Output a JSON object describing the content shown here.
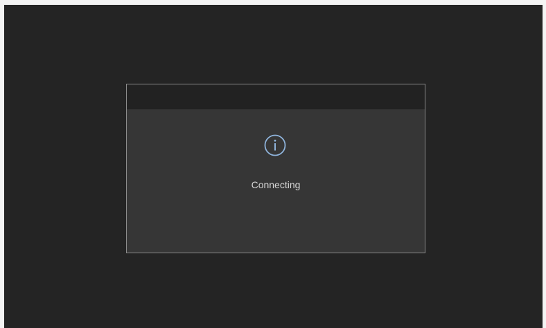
{
  "dialog": {
    "title": "",
    "icon": "info-icon",
    "message": "Connecting"
  },
  "colors": {
    "screen_background": "#242424",
    "dialog_background": "#363636",
    "titlebar_background": "#222222",
    "dialog_border": "#8c8c8c",
    "icon_accent": "#8fb4dc",
    "message_text": "#d6d6d6"
  }
}
